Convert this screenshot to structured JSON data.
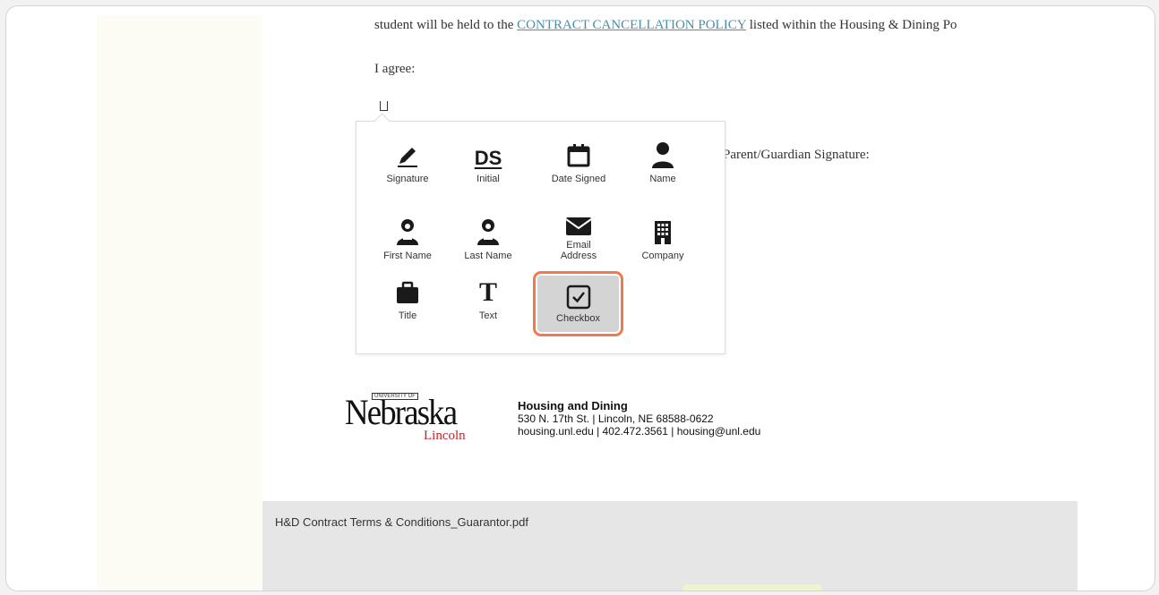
{
  "document": {
    "clause_prefix": "student will be held to the ",
    "clause_link": "CONTRACT CANCELLATION POLICY",
    "clause_suffix": " listed within the Housing & Dining Po",
    "agree_label": "I agree:",
    "guardian_signature_label": "Parent/Guardian Signature:"
  },
  "field_palette": {
    "items": [
      {
        "label": "Signature",
        "icon": "pen-icon"
      },
      {
        "label": "Initial",
        "icon": "ds-initial-icon",
        "icon_text": "DS"
      },
      {
        "label": "Date Signed",
        "icon": "calendar-icon"
      },
      {
        "label": "Name",
        "icon": "person-icon"
      },
      {
        "label": "First Name",
        "icon": "person-id-icon"
      },
      {
        "label": "Last Name",
        "icon": "person-id-icon"
      },
      {
        "label": "Email\nAddress",
        "icon": "envelope-icon"
      },
      {
        "label": "Company",
        "icon": "building-icon"
      },
      {
        "label": "Title",
        "icon": "briefcase-icon"
      },
      {
        "label": "Text",
        "icon": "text-icon",
        "icon_text": "T"
      },
      {
        "label": "Checkbox",
        "icon": "checkbox-icon",
        "selected": true
      }
    ]
  },
  "letterhead": {
    "logo_word": "Nebraska",
    "logo_university": "UNIVERSITY OF",
    "logo_campus": "Lincoln",
    "department": "Housing and Dining",
    "address": "530 N. 17th St. | Lincoln, NE 68588-0622",
    "contact": "housing.unl.edu | 402.472.3561 | housing@unl.edu"
  },
  "footer": {
    "filename": "H&D Contract Terms & Conditions_Guarantor.pdf"
  },
  "colors": {
    "selection_outline": "#f07a4f",
    "link": "#4a8fa8",
    "lincoln_red": "#c0272d"
  }
}
